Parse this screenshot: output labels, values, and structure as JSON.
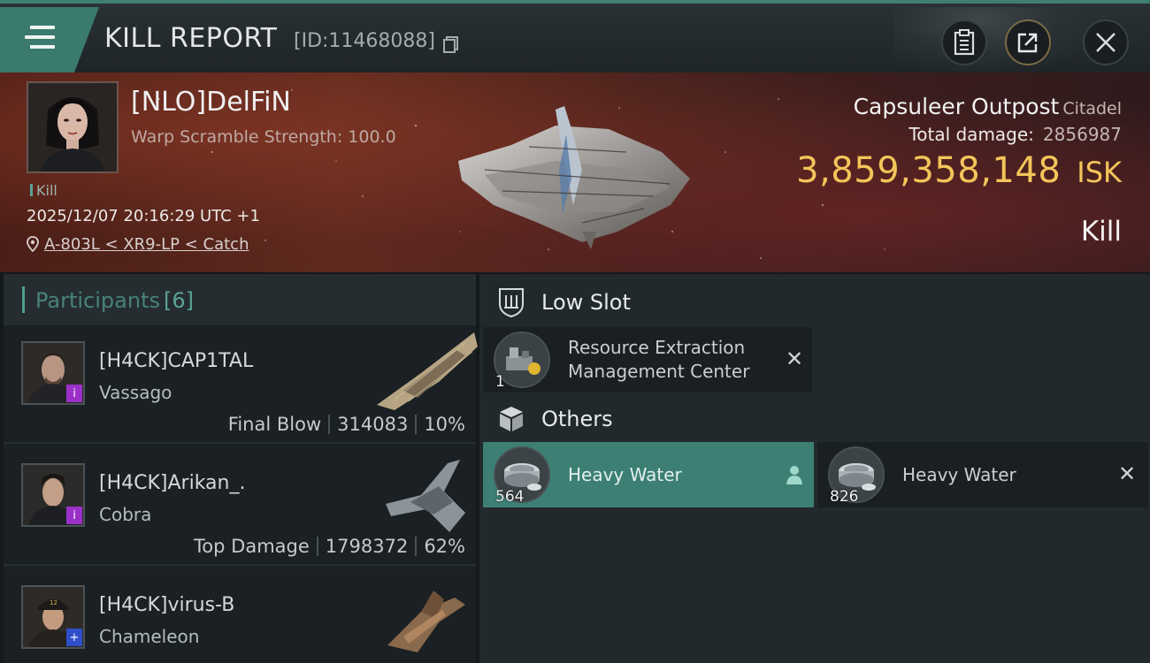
{
  "header": {
    "title": "KILL REPORT",
    "report_id": "[ID:11468088]",
    "icons": [
      "menu-icon",
      "copy-icon",
      "clipboard-icon",
      "share-icon",
      "close-icon"
    ]
  },
  "victim": {
    "name": "[NLO]DelFiN",
    "subtitle": "Warp Scramble Strength: 100.0",
    "tag": "Kill",
    "time": "2025/12/07 20:16:29 UTC +1",
    "location": "A-803L < XR9-LP < Catch",
    "ship_name": "Capsuleer Outpost",
    "ship_class": "Citadel",
    "total_damage_label": "Total damage:",
    "total_damage": "2856987",
    "isk_value": "3,859,358,148",
    "isk_unit": "ISK",
    "kill_label": "Kill"
  },
  "participants": {
    "title": "Participants",
    "count": "[6]",
    "rows": [
      {
        "name": "[H4CK]CAP1TAL",
        "ship": "Vassago",
        "role": "Final Blow",
        "damage": "314083",
        "percent": "10%",
        "badge": "i",
        "badge_color": "#9b30c9"
      },
      {
        "name": "[H4CK]Arikan_.",
        "ship": "Cobra",
        "role": "Top Damage",
        "damage": "1798372",
        "percent": "62%",
        "badge": "i",
        "badge_color": "#9b30c9"
      },
      {
        "name": "[H4CK]virus-B",
        "ship": "Chameleon",
        "role": "",
        "damage": "",
        "percent": "",
        "badge": "+",
        "badge_color": "#2f4fc8"
      }
    ]
  },
  "slots": {
    "low_slot": {
      "title": "Low Slot",
      "items": [
        {
          "qty": "1",
          "name_line1": "Resource Extraction",
          "name_line2": "Management Center"
        }
      ]
    },
    "others": {
      "title": "Others",
      "items": [
        {
          "qty": "564",
          "name": "Heavy Water",
          "selected": true
        },
        {
          "qty": "826",
          "name": "Heavy Water",
          "selected": false
        }
      ]
    }
  },
  "colors": {
    "accent": "#3d7f74",
    "isk": "#f3c55a",
    "banner": "#4b1e17"
  }
}
